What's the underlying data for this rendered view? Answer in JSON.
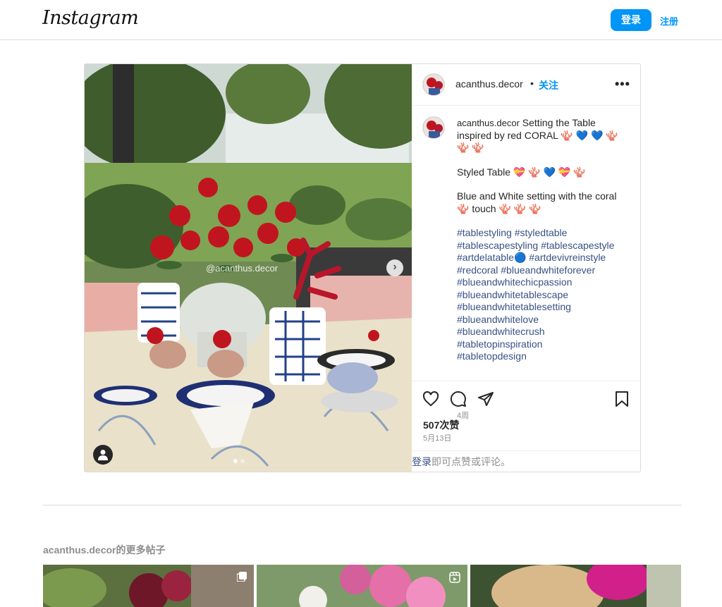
{
  "header": {
    "logo": "Instagram",
    "login_label": "登录",
    "signup_label": "注册"
  },
  "post": {
    "username": "acanthus.decor",
    "separator": "•",
    "follow_label": "关注",
    "more_label": "•••",
    "watermark": "@acanthus.decor",
    "caption": {
      "username": "acanthus.decor",
      "line1": "Setting the Table inspired by red CORAL 🪸 💙 💙 🪸 🪸 🪸",
      "line2": "Styled Table 💝 🪸 💙 💝 🪸",
      "line3": "Blue and White setting with the coral 🪸 touch 🪸 🪸 🪸",
      "hashtags": [
        "#tablestyling #styledtable",
        "#tablescapestyling #tablescapestyle",
        "#artdelatable🔵 #artdevivreinstyle",
        "#redcoral #blueandwhiteforever",
        "#blueandwhitechicpassion",
        "#blueandwhitetablescape",
        "#blueandwhitetablesetting",
        "#blueandwhitelove",
        "#blueandwhitecrush",
        "#tabletopinspiration",
        "#tabletopdesign"
      ],
      "ago": "4周"
    },
    "likes": "507次赞",
    "date": "5月13日",
    "login_prompt_link": "登录",
    "login_prompt_rest": "即可点赞或评论。"
  },
  "more_posts": {
    "title": "acanthus.decor的更多帖子"
  },
  "colors": {
    "accent": "#0095f6",
    "hashtag": "#385185",
    "muted": "#8e8e8e"
  },
  "icons": {
    "like": "heart-icon",
    "comment": "comment-icon",
    "share": "paper-plane-icon",
    "save": "bookmark-icon"
  }
}
